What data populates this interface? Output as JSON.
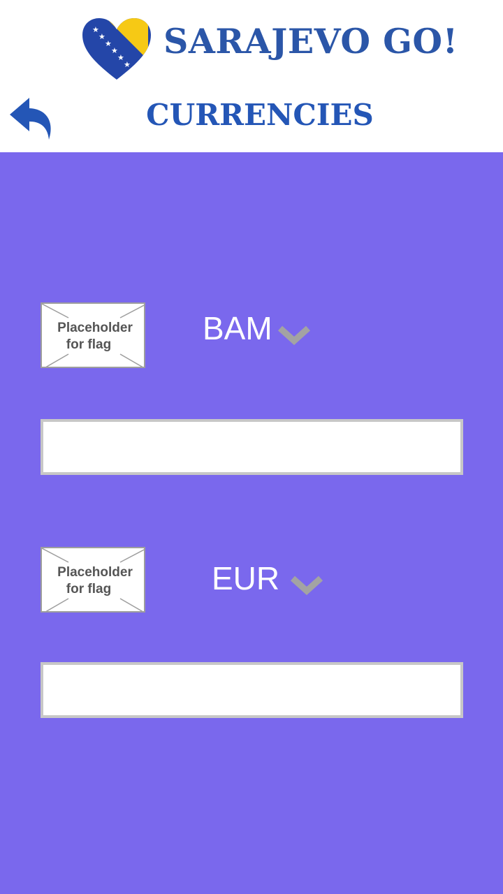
{
  "header": {
    "app_name": "SARAJEVO GO!",
    "page_title": "CURRENCIES",
    "logo_icon": "bosnia-heart-logo",
    "back_icon": "reply-arrow-icon"
  },
  "colors": {
    "brand_blue": "#2456b6",
    "background": "#7a68ed",
    "input_border": "#c7c7c7",
    "chevron": "#a3a3a3"
  },
  "converter": {
    "from": {
      "flag_placeholder_line1": "Placeholder",
      "flag_placeholder_line2": "for flag",
      "currency": "BAM",
      "amount": ""
    },
    "to": {
      "flag_placeholder_line1": "Placeholder",
      "flag_placeholder_line2": "for flag",
      "currency": "EUR",
      "amount": ""
    }
  }
}
